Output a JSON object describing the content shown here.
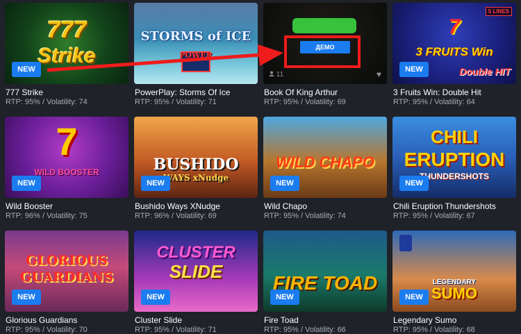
{
  "games": [
    {
      "title": "777 Strike",
      "meta": "RTP: 95% / Volatility: 74",
      "badge": "NEW",
      "art": [
        "777",
        "Strike"
      ]
    },
    {
      "title": "PowerPlay: Storms Of Ice",
      "meta": "RTP: 95% / Volatility: 71",
      "badge": "",
      "art": [
        "STORMS of ICE",
        "POWER"
      ]
    },
    {
      "title": "Book Of King Arthur",
      "meta": "RTP: 95% / Volatility: 69",
      "badge": "",
      "demo_label": "ДЕМО",
      "likes": "11"
    },
    {
      "title": "3 Fruits Win: Double Hit",
      "meta": "RTP: 95% / Volatility: 64",
      "badge": "NEW",
      "art": [
        "3 FRUITS Win",
        "7"
      ],
      "lines_tag": "5 LINES",
      "double_hit": "Double HIT"
    },
    {
      "title": "Wild Booster",
      "meta": "RTP: 96% / Volatility: 75",
      "badge": "NEW",
      "art": [
        "7",
        "WILD BOOSTER"
      ]
    },
    {
      "title": "Bushido Ways XNudge",
      "meta": "RTP: 96% / Volatility: 69",
      "badge": "NEW",
      "art": [
        "BUSHIDO",
        "WAYS xNudge"
      ]
    },
    {
      "title": "Wild Chapo",
      "meta": "RTP: 95% / Volatility: 74",
      "badge": "NEW",
      "art": [
        "WILD CHAPO"
      ]
    },
    {
      "title": "Chili Eruption Thundershots",
      "meta": "RTP: 95% / Volatility: 67",
      "badge": "NEW",
      "art": [
        "CHILI",
        "ERUPTION",
        "THUNDERSHOTS"
      ]
    },
    {
      "title": "Glorious Guardians",
      "meta": "RTP: 95% / Volatility: 70",
      "badge": "NEW",
      "art": [
        "GLORIOUS",
        "GUARDIANS"
      ]
    },
    {
      "title": "Cluster Slide",
      "meta": "RTP: 95% / Volatility: 71",
      "badge": "NEW",
      "art": [
        "CLUSTER",
        "SLIDE"
      ]
    },
    {
      "title": "Fire Toad",
      "meta": "RTP: 95% / Volatility: 66",
      "badge": "NEW",
      "art": [
        "FIRE TOAD"
      ]
    },
    {
      "title": "Legendary Sumo",
      "meta": "RTP: 95% / Volatility: 68",
      "badge": "NEW",
      "art": [
        "LEGENDARY",
        "SUMO"
      ]
    }
  ],
  "colors": {
    "background": "#1f2228",
    "badge": "#1b7cf0",
    "annotation": "#ee1c1c",
    "play_bar": "#37c13d"
  },
  "icons": {
    "likes": "user-icon",
    "favorite": "heart-icon"
  }
}
